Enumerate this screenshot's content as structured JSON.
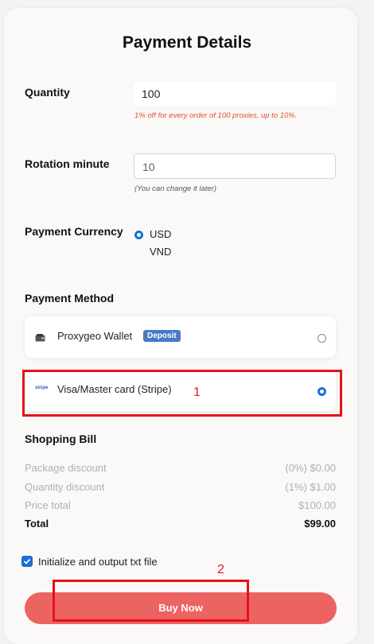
{
  "title": "Payment Details",
  "quantity": {
    "label": "Quantity",
    "value": "100",
    "hint": "1% off for every order of 100 proxies, up to 10%."
  },
  "rotation": {
    "label": "Rotation minute",
    "value": "10",
    "hint": "(You can change it later)"
  },
  "currency": {
    "label": "Payment Currency",
    "options": [
      "USD",
      "VND"
    ],
    "selected": "USD"
  },
  "method": {
    "label": "Payment Method",
    "wallet": {
      "label": "Proxygeo Wallet",
      "badge": "Deposit"
    },
    "card": {
      "label": "Visa/Master card (Stripe)",
      "logo_text": "stripe"
    },
    "selected": "card"
  },
  "bill": {
    "label": "Shopping Bill",
    "rows": [
      {
        "label": "Package discount",
        "value": "(0%) $0.00"
      },
      {
        "label": "Quantity discount",
        "value": "(1%) $1.00"
      },
      {
        "label": "Price total",
        "value": "$100.00"
      }
    ],
    "total": {
      "label": "Total",
      "value": "$99.00"
    }
  },
  "output_txt": {
    "label": "Initialize and output txt file",
    "checked": true
  },
  "buy_label": "Buy Now",
  "annotations": [
    "1",
    "2"
  ],
  "colors": {
    "accent": "#1a6fd6",
    "buy_button": "#ec6462",
    "hint": "#e0532f",
    "annotation": "#e8101a"
  }
}
